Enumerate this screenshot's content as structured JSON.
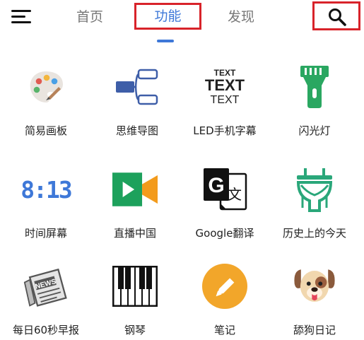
{
  "header": {
    "tabs": [
      {
        "label": "首页"
      },
      {
        "label": "功能"
      },
      {
        "label": "发现"
      }
    ]
  },
  "grid": {
    "items": [
      {
        "label": "简易画板",
        "icon": "palette-icon"
      },
      {
        "label": "思维导图",
        "icon": "mindmap-icon"
      },
      {
        "label": "LED手机字幕",
        "icon": "led-text-icon",
        "icon_text": [
          "TEXT",
          "TEXT",
          "TEXT"
        ]
      },
      {
        "label": "闪光灯",
        "icon": "flashlight-icon"
      },
      {
        "label": "时间屏幕",
        "icon": "clock-digits-icon",
        "icon_text": "8:13"
      },
      {
        "label": "直播中国",
        "icon": "live-video-icon"
      },
      {
        "label": "Google翻译",
        "icon": "google-translate-icon",
        "icon_text": [
          "G",
          "文"
        ]
      },
      {
        "label": "历史上的今天",
        "icon": "history-today-icon"
      },
      {
        "label": "每日60秒早报",
        "icon": "newspaper-icon",
        "icon_text": "NEWS"
      },
      {
        "label": "钢琴",
        "icon": "piano-icon"
      },
      {
        "label": "笔记",
        "icon": "note-pencil-icon"
      },
      {
        "label": "舔狗日记",
        "icon": "dog-face-icon"
      }
    ]
  },
  "colors": {
    "accent": "#3e78d8",
    "highlight_box": "#d8232a",
    "flashlight_green": "#2aa761",
    "live_green": "#1da15c",
    "live_orange": "#f39b1c",
    "note_orange": "#f2a62a"
  }
}
